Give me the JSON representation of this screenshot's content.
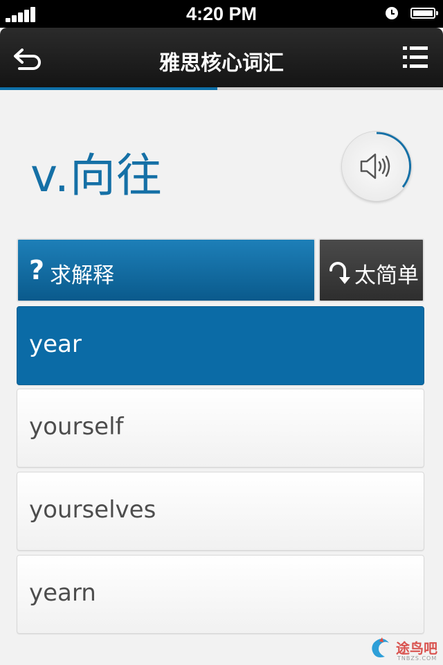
{
  "status_bar": {
    "time": "4:20 PM",
    "icons": [
      "signal-icon",
      "alarm-icon",
      "battery-icon"
    ]
  },
  "nav": {
    "title": "雅思核心词汇",
    "back_icon": "back-arrow-icon",
    "menu_icon": "list-menu-icon",
    "progress_fraction": 0.49
  },
  "word": {
    "definition": "v.向往",
    "audio_icon": "speaker-icon"
  },
  "actions": {
    "hint_symbol": "?",
    "hint_label": "求解释",
    "easy_label": "太简单",
    "easy_icon": "curved-arrow-down-icon"
  },
  "options": [
    {
      "text": "year",
      "selected": true
    },
    {
      "text": "yourself",
      "selected": false
    },
    {
      "text": "yourselves",
      "selected": false
    },
    {
      "text": "yearn",
      "selected": false
    }
  ],
  "watermark": {
    "text": "途鸟吧",
    "sub": "TNBZS.COM"
  },
  "colors": {
    "accent": "#0b6ba6",
    "nav_bg": "#1c1c1c",
    "option_text": "#4d4d4d",
    "easy_bg": "#3a3a3a"
  }
}
